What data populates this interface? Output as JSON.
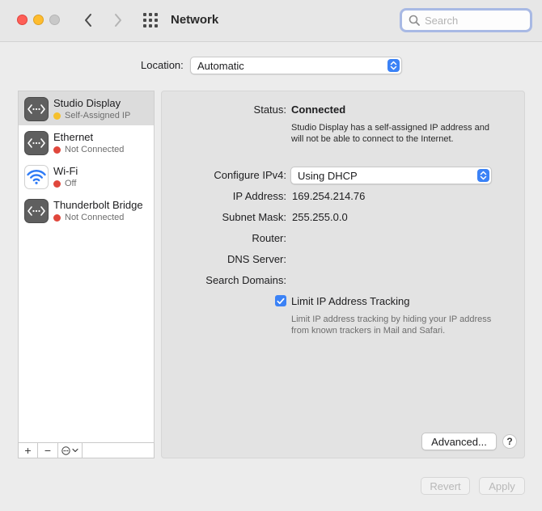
{
  "window": {
    "title": "Network"
  },
  "search": {
    "placeholder": "Search"
  },
  "location": {
    "label": "Location:",
    "value": "Automatic"
  },
  "services": [
    {
      "name": "Studio Display",
      "status": "Self-Assigned IP",
      "status_color": "#f5c02d",
      "icon": "ethernet-arrows-icon",
      "selected": true
    },
    {
      "name": "Ethernet",
      "status": "Not Connected",
      "status_color": "#e0473c",
      "icon": "ethernet-arrows-icon",
      "selected": false
    },
    {
      "name": "Wi-Fi",
      "status": "Off",
      "status_color": "#e0473c",
      "icon": "wifi-icon",
      "selected": false
    },
    {
      "name": "Thunderbolt Bridge",
      "status": "Not Connected",
      "status_color": "#e0473c",
      "icon": "ethernet-arrows-icon",
      "selected": false
    }
  ],
  "sidebar_tools": {
    "add": "+",
    "remove": "−"
  },
  "detail": {
    "status_label": "Status:",
    "status_value": "Connected",
    "status_description": "Studio Display has a self-assigned IP address and will not be able to connect to the Internet.",
    "configure_label": "Configure IPv4:",
    "configure_value": "Using DHCP",
    "ip_label": "IP Address:",
    "ip_value": "169.254.214.76",
    "subnet_label": "Subnet Mask:",
    "subnet_value": "255.255.0.0",
    "router_label": "Router:",
    "router_value": "",
    "dns_label": "DNS Server:",
    "dns_value": "",
    "search_domains_label": "Search Domains:",
    "search_domains_value": "",
    "limit_tracking_label": "Limit IP Address Tracking",
    "limit_tracking_checked": true,
    "limit_tracking_description": "Limit IP address tracking by hiding your IP address from known trackers in Mail and Safari."
  },
  "buttons": {
    "advanced": "Advanced...",
    "help": "?",
    "revert": "Revert",
    "apply": "Apply"
  },
  "colors": {
    "accent": "#3b82f6",
    "status_yellow": "#f5c02d",
    "status_red": "#e0473c"
  }
}
